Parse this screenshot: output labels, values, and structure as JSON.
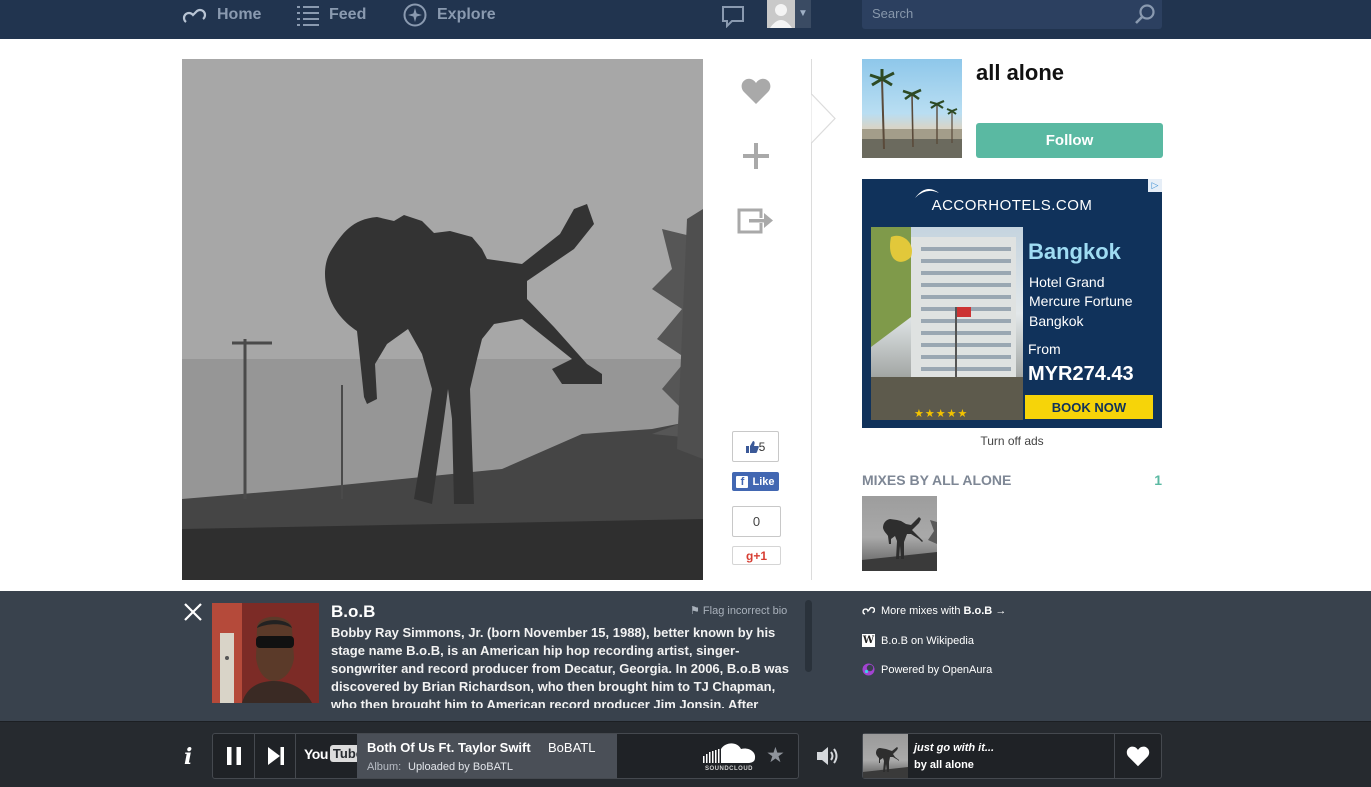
{
  "nav": {
    "home": "Home",
    "feed": "Feed",
    "explore": "Explore",
    "search_placeholder": "Search"
  },
  "user": {
    "name": "all alone",
    "follow_label": "Follow"
  },
  "social": {
    "fb_count": "5",
    "fb_like": "Like",
    "gplus_count": "0",
    "gplus_label": "+1"
  },
  "ad": {
    "brand": "ACCORHOTELS.COM",
    "city": "Bangkok",
    "hotel_lines": [
      "Hotel Grand",
      "Mercure Fortune",
      "Bangkok"
    ],
    "from": "From",
    "price": "MYR274.43",
    "cta": "BOOK NOW",
    "stars": "★★★★★",
    "turn_off": "Turn off ads"
  },
  "mixes": {
    "title": "MIXES BY ALL ALONE",
    "count": "1"
  },
  "artist_info": {
    "name": "B.o.B",
    "flag": "⚑ Flag incorrect bio",
    "bio_1": "Bobby Ray Simmons, Jr. (born November 15, 1988), better known by his stage name ",
    "bio_bold": "B.o.B",
    "bio_2": ", is an American hip hop recording artist, singer-songwriter and record producer from Decatur, Georgia. In 2006, B.o.B was discovered by Brian Richardson, who then brought him to TJ Chapman, who then brought him to American record producer Jim Jonsin. After",
    "more_mixes": "More mixes with ",
    "more_mixes_artist": "B.o.B",
    "more_mixes_arrow": "→",
    "wikipedia": "B.o.B on Wikipedia",
    "powered_by": "Powered by OpenAura"
  },
  "player": {
    "info": "i",
    "youtube_you": "You",
    "youtube_tube": "Tube",
    "track_title": "Both Of Us Ft. Taylor Swift",
    "track_artist": "BoBATL",
    "album_label": "Album:",
    "album_value": "Uploaded by BoBATL",
    "soundcloud_label": "SOUNDCLOUD",
    "star": "★",
    "next_mix_title": "just go with it...",
    "next_mix_by": "by all alone"
  },
  "colors": {
    "nav_bg": "#21344f",
    "accent": "#5ab9a2",
    "panel_bg": "#39424d",
    "player_bg": "#262a2f"
  }
}
